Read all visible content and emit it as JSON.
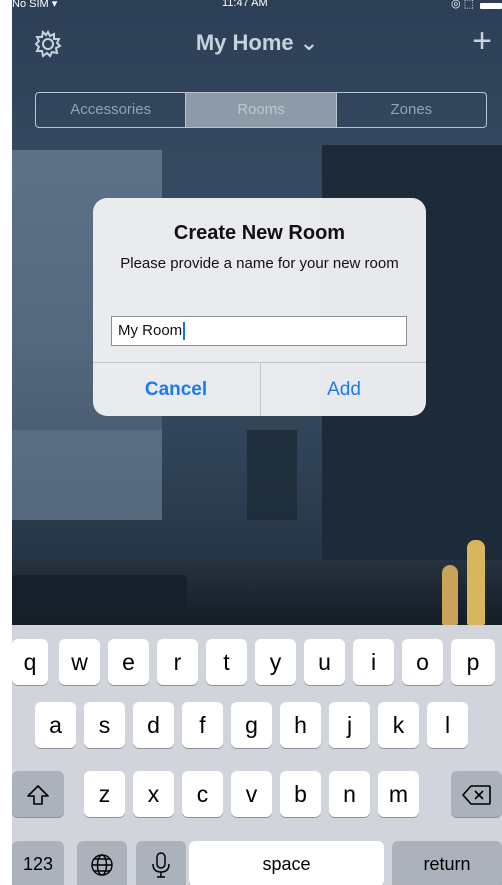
{
  "status": {
    "carrier": "No SIM ▾",
    "time": "11:47 AM",
    "icons": "◎ ⬚"
  },
  "nav": {
    "title": "My Home ⌄",
    "settings_icon": "gear-icon",
    "add_label": "+"
  },
  "tabs": [
    {
      "label": "Accessories",
      "active": false
    },
    {
      "label": "Rooms",
      "active": true
    },
    {
      "label": "Zones",
      "active": false
    }
  ],
  "dialog": {
    "title": "Create New Room",
    "message": "Please provide a name for your new room",
    "input_value": "My Room",
    "cancel_label": "Cancel",
    "add_label": "Add"
  },
  "keyboard": {
    "row1": [
      "q",
      "w",
      "e",
      "r",
      "t",
      "y",
      "u",
      "i",
      "o",
      "p"
    ],
    "row2": [
      "a",
      "s",
      "d",
      "f",
      "g",
      "h",
      "j",
      "k",
      "l"
    ],
    "row3": [
      "z",
      "x",
      "c",
      "v",
      "b",
      "n",
      "m"
    ],
    "shift_icon": "shift-icon",
    "delete_icon": "delete-icon",
    "numbers_label": "123",
    "globe_icon": "globe-icon",
    "mic_icon": "microphone-icon",
    "space_label": "space",
    "return_label": "return"
  },
  "colors": {
    "accent": "#1a7cf2",
    "keyboard_bg": "#d1d5db"
  }
}
